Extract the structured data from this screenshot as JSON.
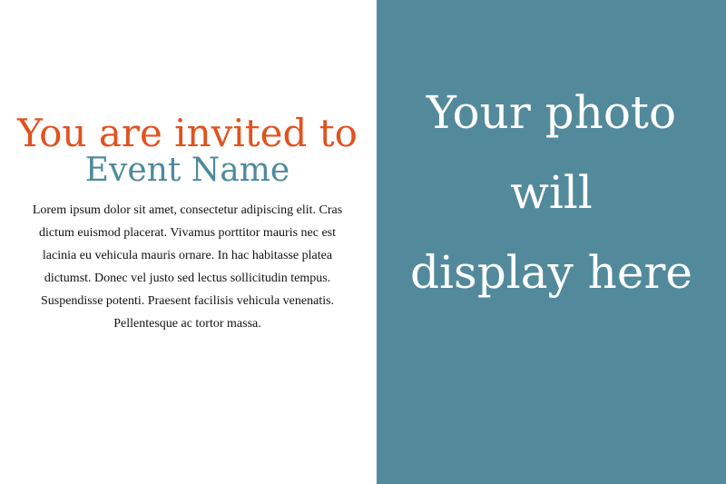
{
  "invitation": {
    "heading": "You are invited to",
    "event_name": "Event Name",
    "body": "Lorem ipsum dolor sit amet, consectetur adipiscing elit. Cras dictum euismod placerat. Vivamus porttitor mauris nec est lacinia eu vehicula mauris ornare. In hac habitasse platea dictumst. Donec vel justo sed lectus sollicitudin tempus. Suspendisse potenti. Praesent facilisis vehicula venenatis. Pellentesque ac tortor massa."
  },
  "photo_placeholder": {
    "line1": "Your photo",
    "line2": "will",
    "line3": "display here"
  },
  "colors": {
    "heading": "#e0531f",
    "event_name": "#4d8a9c",
    "photo_panel": "#528a9c",
    "photo_text": "#ffffff"
  }
}
